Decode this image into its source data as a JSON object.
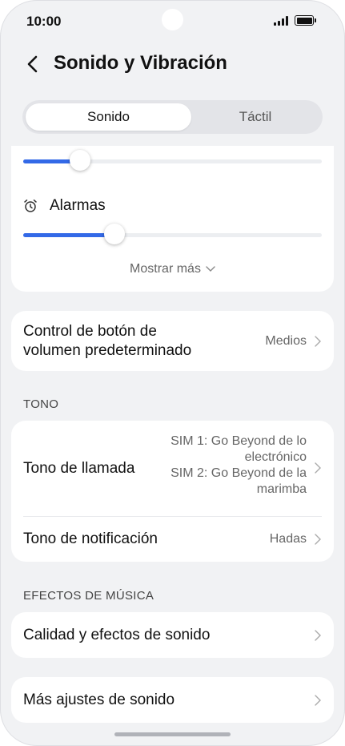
{
  "status_bar": {
    "time": "10:00"
  },
  "header": {
    "title": "Sonido y Vibración"
  },
  "segments": [
    {
      "label": "Sonido",
      "active": true
    },
    {
      "label": "Táctil",
      "active": false
    }
  ],
  "volume_card": {
    "top_slider_level": 0.19,
    "alarms_label": "Alarmas",
    "alarms_level": 0.305,
    "show_more": "Mostrar más"
  },
  "volume_button": {
    "title_line1": "Control de botón de",
    "title_line2": "volumen predeterminado",
    "value": "Medios"
  },
  "tono": {
    "section_title": "TONO",
    "ringtone": {
      "title": "Tono de llamada",
      "sim1_line1": "SIM 1: Go Beyond de lo",
      "sim1_line2": "electrónico",
      "sim2_line1": "SIM 2: Go Beyond de la",
      "sim2_line2": "marimba"
    },
    "notification": {
      "title": "Tono de notificación",
      "value": "Hadas"
    }
  },
  "music_effects": {
    "section_title": "EFECTOS DE MÚSICA",
    "quality": {
      "title": "Calidad y efectos de sonido"
    }
  },
  "more_settings": {
    "title": "Más ajustes de sonido"
  },
  "colors": {
    "accent": "#3369e7",
    "background": "#f1f2f4",
    "card": "#ffffff"
  }
}
